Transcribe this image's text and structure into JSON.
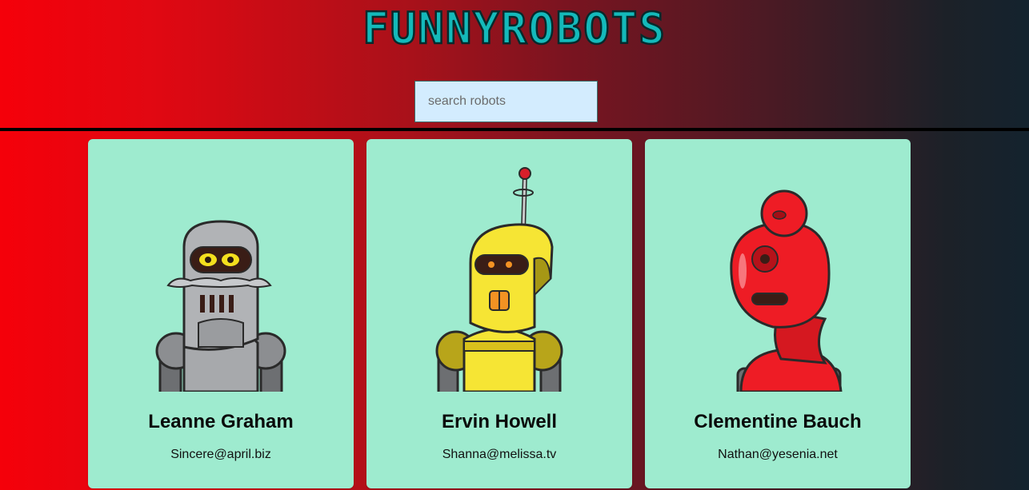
{
  "app": {
    "title": "FUNNYROBOTS"
  },
  "search": {
    "placeholder": "search robots",
    "value": ""
  },
  "robots": [
    {
      "name": "Leanne Graham",
      "email": "Sincere@april.biz",
      "color": "#a7a9ac"
    },
    {
      "name": "Ervin Howell",
      "email": "Shanna@melissa.tv",
      "color": "#f6e534"
    },
    {
      "name": "Clementine Bauch",
      "email": "Nathan@yesenia.net",
      "color": "#ee1c25"
    }
  ],
  "colors": {
    "logo": "#16c3c4",
    "card_bg": "#9eebcf",
    "search_bg": "#d3ecfe"
  },
  "icons": {
    "robot_images": [
      "robot-avatar-gray",
      "robot-avatar-yellow",
      "robot-avatar-red"
    ]
  }
}
